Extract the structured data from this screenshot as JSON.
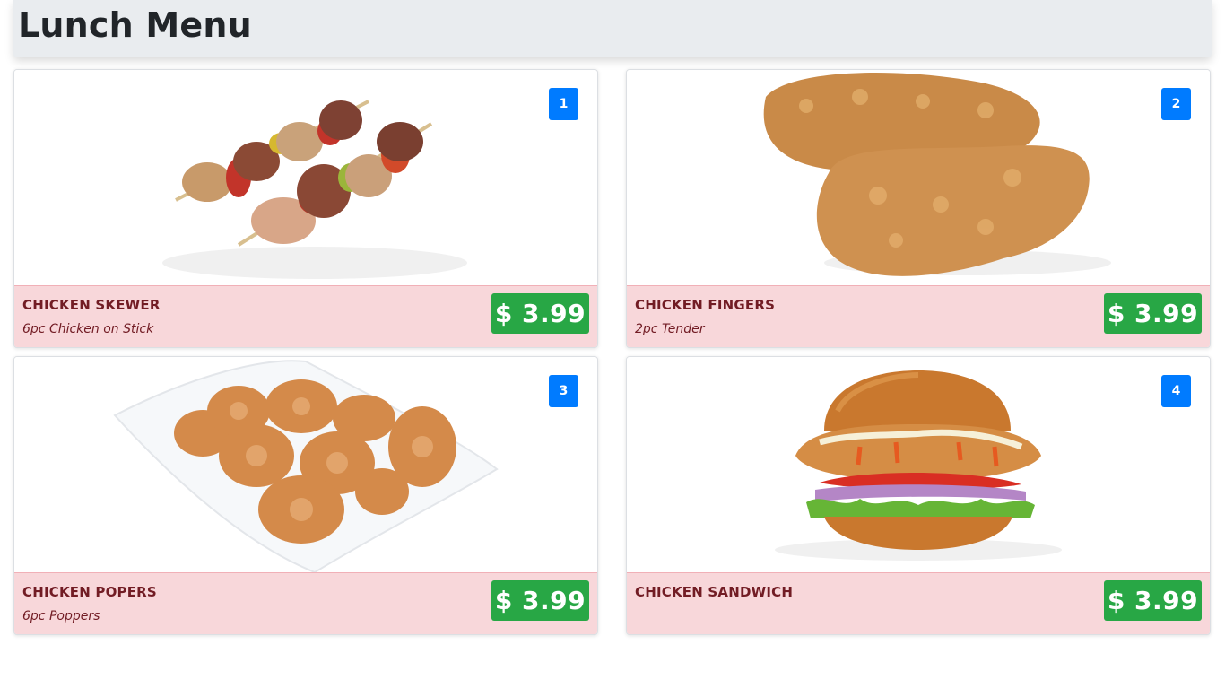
{
  "header": {
    "title": "Lunch Menu"
  },
  "items": [
    {
      "number": "1",
      "name": "CHICKEN SKEWER",
      "description": "6pc Chicken on Stick",
      "price": "$ 3.99"
    },
    {
      "number": "2",
      "name": "CHICKEN FINGERS",
      "description": "2pc Tender",
      "price": "$ 3.99"
    },
    {
      "number": "3",
      "name": "CHICKEN POPERS",
      "description": "6pc Poppers",
      "price": "$ 3.99"
    },
    {
      "number": "4",
      "name": "CHICKEN SANDWICH",
      "description": "",
      "price": "$ 3.99"
    }
  ],
  "colors": {
    "header_bg": "#e9ecef",
    "badge": "#007bff",
    "info_bg": "#f8d7da",
    "info_text": "#721c24",
    "price_bg": "#28a745"
  }
}
